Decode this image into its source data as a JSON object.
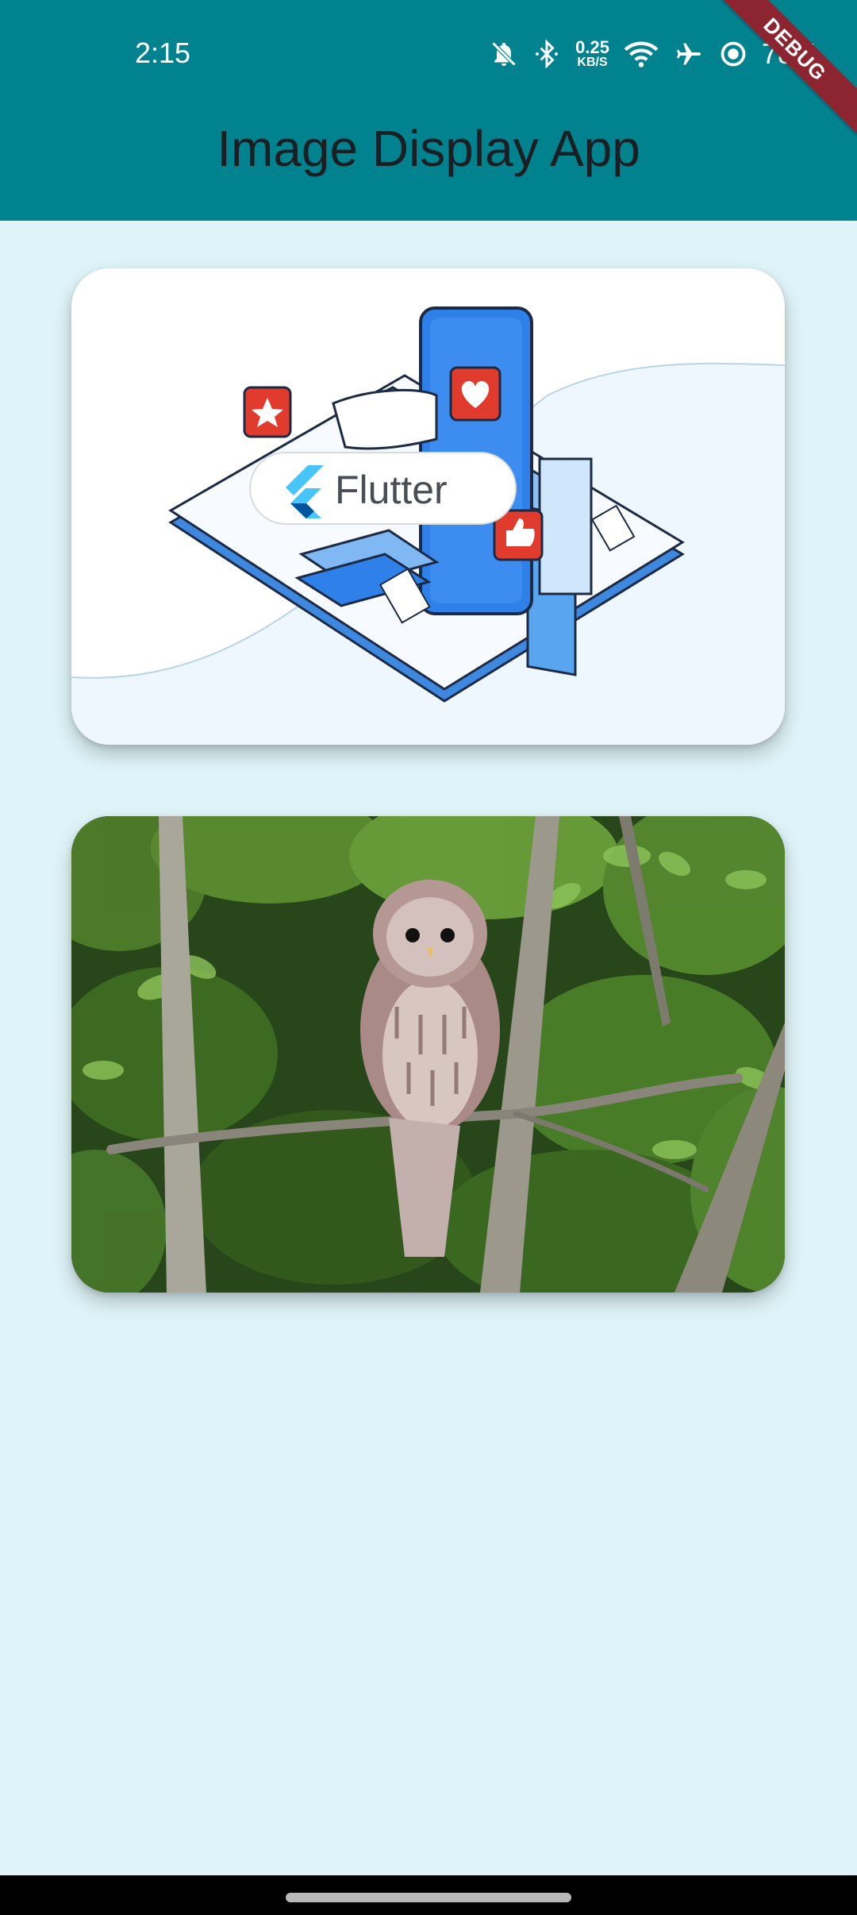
{
  "status_bar": {
    "time": "2:15",
    "net_speed_value": "0.25",
    "net_speed_unit": "KB/S",
    "battery": "78%",
    "icons": [
      "bell-off-icon",
      "bluetooth-icon",
      "wifi-icon",
      "airplane-icon",
      "data-saver-icon"
    ]
  },
  "app_bar": {
    "title": "Image Display App",
    "color": "#00838f"
  },
  "debug_banner": {
    "label": "DEBUG",
    "color": "#8d2531"
  },
  "cards": [
    {
      "image": "flutter-illustration",
      "caption_in_image": "Flutter"
    },
    {
      "image": "barred-owl-photo"
    }
  ],
  "background_color": "#dff4f8"
}
